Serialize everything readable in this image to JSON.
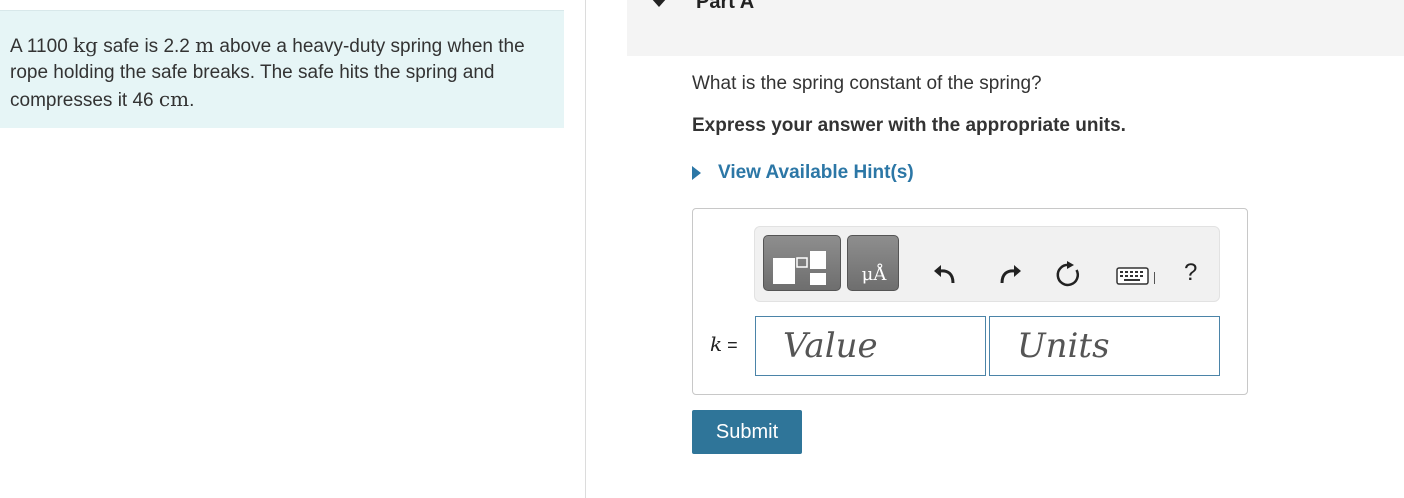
{
  "problem": {
    "prefix1": "A 1100 ",
    "unit_mass": "kg",
    "middle1": " safe is 2.2 ",
    "unit_length": "m",
    "middle2": " above a heavy-duty spring when the rope holding the safe breaks. The safe hits the spring and compresses it 46 ",
    "unit_cm": "cm",
    "suffix": "."
  },
  "part": {
    "title": "Part A"
  },
  "question": {
    "text": "What is the spring constant of the spring?",
    "instruction": "Express your answer with the appropriate units."
  },
  "hint": {
    "label": "View Available Hint(s)"
  },
  "answer": {
    "variable": "k",
    "equals": " =",
    "value_placeholder": "Value",
    "units_placeholder": "Units",
    "units_button_label": "μÅ",
    "help_label": "?"
  },
  "submit": {
    "label": "Submit"
  },
  "colors": {
    "accent": "#2f7599",
    "link": "#2c77a6",
    "problem_bg": "#e6f5f6"
  }
}
